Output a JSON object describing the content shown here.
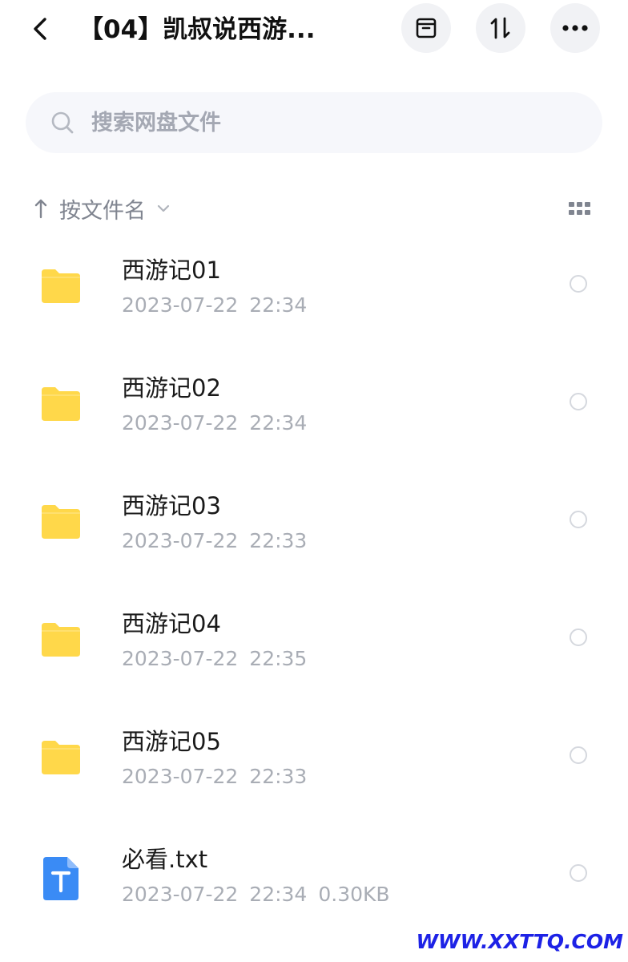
{
  "header": {
    "title": "【04】凯叔说西游...",
    "back_icon": "chevron-left-icon",
    "buttons": [
      {
        "icon": "archive-icon"
      },
      {
        "icon": "sort-order-icon"
      },
      {
        "icon": "more-horizontal-icon"
      }
    ]
  },
  "search": {
    "placeholder": "搜索网盘文件",
    "value": "",
    "icon": "search-icon"
  },
  "sortbar": {
    "label": "按文件名",
    "direction_icon": "arrow-up-icon",
    "view_icon": "grid-view-icon"
  },
  "files": [
    {
      "type": "folder",
      "name": "西游记01",
      "date": "2023-07-22",
      "time": "22:34",
      "size": ""
    },
    {
      "type": "folder",
      "name": "西游记02",
      "date": "2023-07-22",
      "time": "22:34",
      "size": ""
    },
    {
      "type": "folder",
      "name": "西游记03",
      "date": "2023-07-22",
      "time": "22:33",
      "size": ""
    },
    {
      "type": "folder",
      "name": "西游记04",
      "date": "2023-07-22",
      "time": "22:35",
      "size": ""
    },
    {
      "type": "folder",
      "name": "西游记05",
      "date": "2023-07-22",
      "time": "22:33",
      "size": ""
    },
    {
      "type": "txt",
      "name": "必看.txt",
      "date": "2023-07-22",
      "time": "22:34",
      "size": "0.30KB"
    }
  ],
  "colors": {
    "folder": "#ffd84a",
    "txt_icon": "#3a8bf5",
    "text_primary": "#1a1a1a",
    "text_secondary": "#a9adb5",
    "watermark": "#1d22e6"
  },
  "watermark": "WWW.XXTTQ.COM"
}
